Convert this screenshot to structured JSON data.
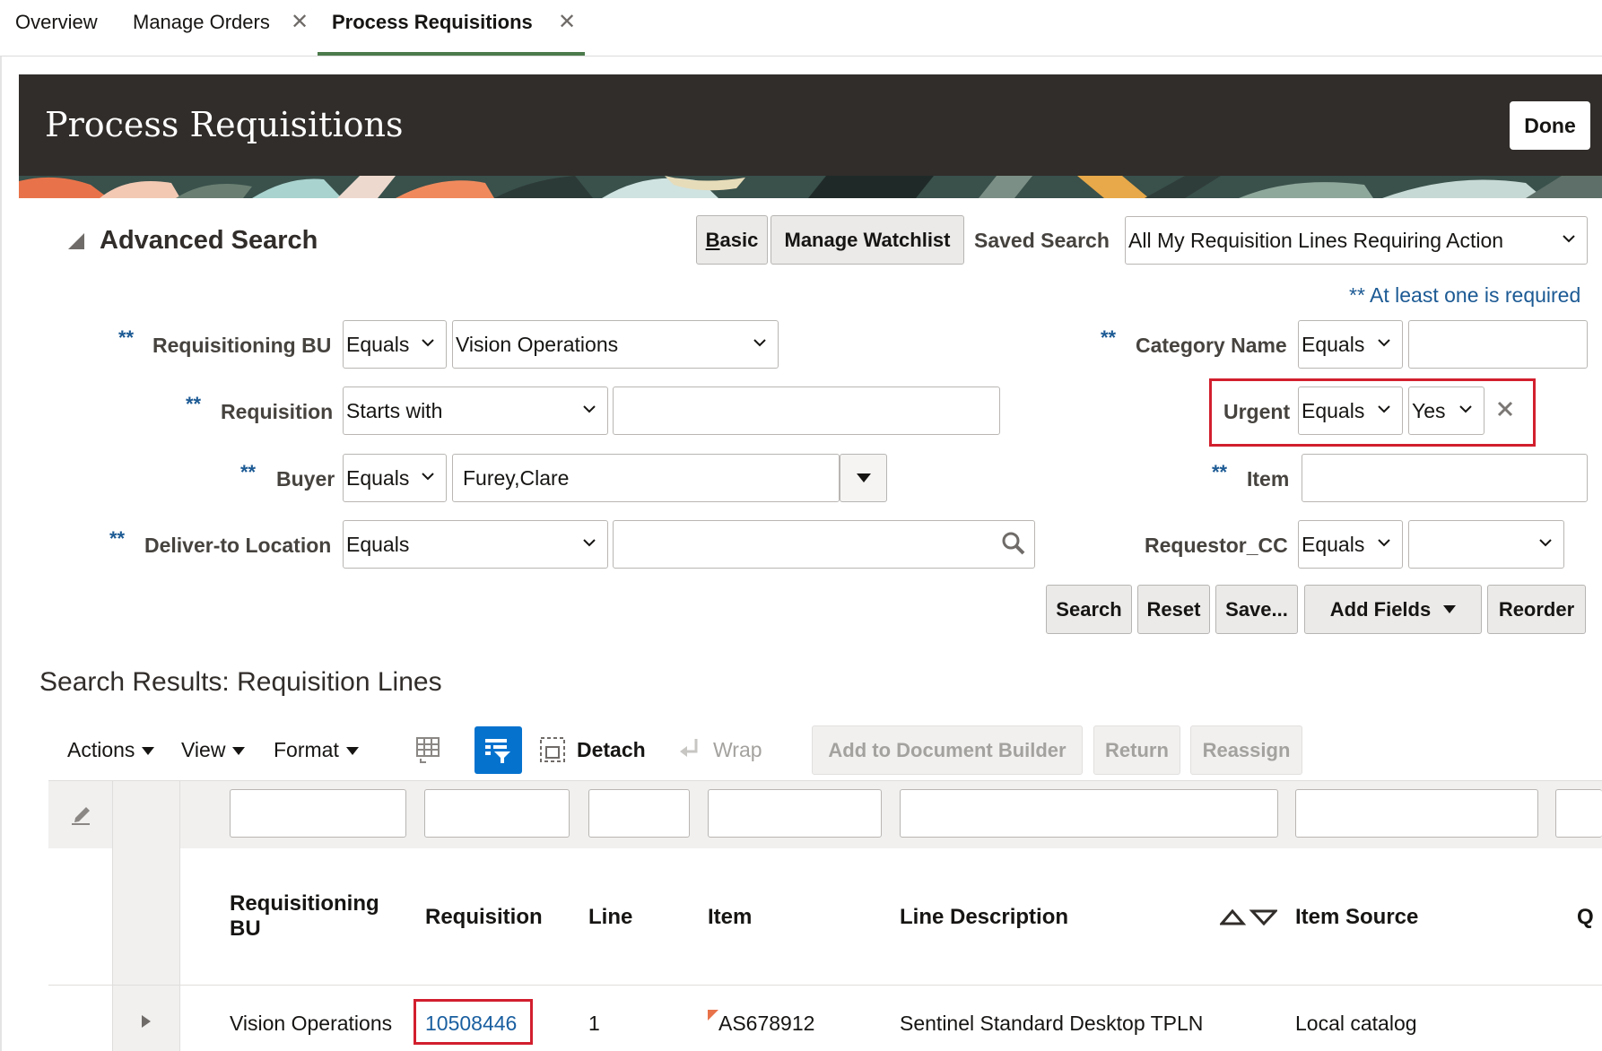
{
  "tabs": [
    {
      "label": "Overview",
      "closable": false,
      "active": false
    },
    {
      "label": "Manage Orders",
      "closable": true,
      "active": false
    },
    {
      "label": "Process Requisitions",
      "closable": true,
      "active": true
    }
  ],
  "header": {
    "title": "Process Requisitions",
    "done_label": "Done"
  },
  "search": {
    "title": "Advanced Search",
    "basic_label": "Basic",
    "watchlist_label": "Manage Watchlist",
    "saved_search_label": "Saved Search",
    "saved_search_value": "All My Requisition Lines Requiring Action",
    "required_note": "** At least one is required",
    "required_marker": "**",
    "fields": {
      "req_bu": {
        "label": "Requisitioning BU",
        "operator": "Equals",
        "value": "Vision Operations"
      },
      "requisition": {
        "label": "Requisition",
        "operator": "Starts with",
        "value": ""
      },
      "buyer": {
        "label": "Buyer",
        "operator": "Equals",
        "value": "Furey,Clare"
      },
      "deliver_to": {
        "label": "Deliver-to Location",
        "operator": "Equals",
        "value": ""
      },
      "category": {
        "label": "Category Name",
        "operator": "Equals",
        "value": ""
      },
      "urgent": {
        "label": "Urgent",
        "operator": "Equals",
        "value": "Yes"
      },
      "item": {
        "label": "Item",
        "value": ""
      },
      "requestor_cc": {
        "label": "Requestor_CC",
        "operator": "Equals",
        "value": ""
      }
    },
    "buttons": {
      "search": "Search",
      "reset": "Reset",
      "save": "Save...",
      "add_fields": "Add Fields",
      "reorder": "Reorder"
    }
  },
  "results": {
    "title": "Search Results: Requisition Lines",
    "toolbar": {
      "actions": "Actions",
      "view": "View",
      "format": "Format",
      "detach": "Detach",
      "wrap": "Wrap",
      "add_to_doc_builder": "Add to Document Builder",
      "return": "Return",
      "reassign": "Reassign"
    },
    "columns": [
      "Requisitioning BU",
      "Requisition",
      "Line",
      "Item",
      "Line Description",
      "Item Source",
      "Q"
    ],
    "rows": [
      {
        "bu": "Vision Operations",
        "requisition": "10508446",
        "line": "1",
        "item": "AS678912",
        "description": "Sentinel Standard Desktop TPLN",
        "source": "Local catalog"
      }
    ]
  },
  "colors": {
    "accent_green": "#4b7a4b",
    "banner": "#312d2a",
    "highlight_red": "#d21f2e",
    "link_blue": "#1a5fa0",
    "toolbar_blue": "#0572ce"
  }
}
